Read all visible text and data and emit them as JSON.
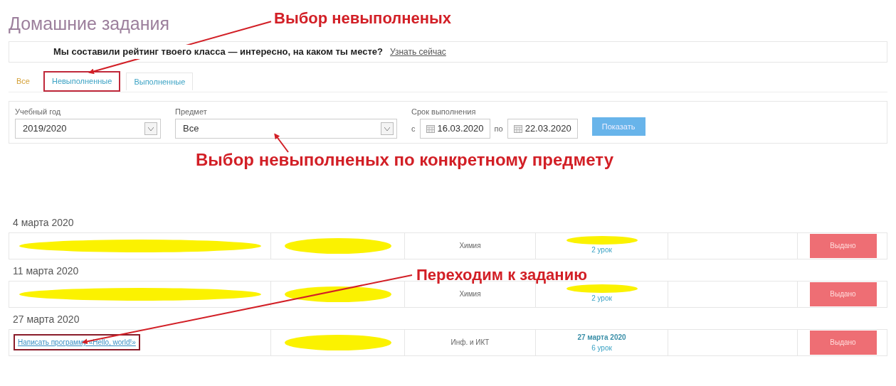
{
  "title": "Домашние задания",
  "notice": {
    "text": "Мы составили рейтинг твоего класса — интересно, на каком ты месте?",
    "link": "Узнать сейчас"
  },
  "tabs": [
    {
      "label": "Все",
      "selected": true,
      "highlighted": false
    },
    {
      "label": "Невыполненные",
      "selected": false,
      "highlighted": true
    },
    {
      "label": "Выполненные",
      "selected": false,
      "highlighted": false
    }
  ],
  "filters": {
    "year": {
      "label": "Учебный год",
      "value": "2019/2020"
    },
    "subject": {
      "label": "Предмет",
      "value": "Все"
    },
    "deadline": {
      "label": "Срок выполнения",
      "from_label": "с",
      "from": "16.03.2020",
      "to_label": "по",
      "to": "22.03.2020"
    },
    "button": "Показать"
  },
  "groups": [
    {
      "date": "4 марта 2020",
      "rows": [
        {
          "task": null,
          "subject": "Химия",
          "due": null,
          "lesson": "2 урок",
          "status": "Выдано"
        }
      ]
    },
    {
      "date": "11 марта 2020",
      "rows": [
        {
          "task": null,
          "subject": "Химия",
          "due": null,
          "lesson": "2 урок",
          "status": "Выдано"
        }
      ]
    },
    {
      "date": "27 марта 2020",
      "rows": [
        {
          "task": "Написать программу «Hello, world!»",
          "task_highlighted": true,
          "subject": "Инф. и ИКТ",
          "due": "27 марта 2020",
          "lesson": "6 урок",
          "status": "Выдано"
        }
      ]
    }
  ],
  "annotations": [
    {
      "text": "Выбор невыполненых"
    },
    {
      "text": "Выбор невыполненых по конкретному предмету"
    },
    {
      "text": "Переходим к заданию"
    }
  ]
}
